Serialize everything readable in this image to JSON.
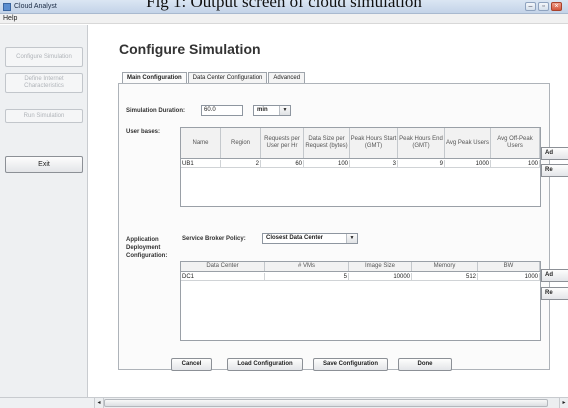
{
  "caption": "Fig 1: Output screen of cloud simulation",
  "window": {
    "title": "Cloud Analyst"
  },
  "menu": {
    "help": "Help"
  },
  "sidebar": {
    "configure": "Configure Simulation",
    "internet": "Define Internet Characteristics",
    "run": "Run Simulation",
    "exit": "Exit"
  },
  "page": {
    "title": "Configure Simulation"
  },
  "tabs": [
    "Main Configuration",
    "Data Center Configuration",
    "Advanced"
  ],
  "simulation": {
    "duration_label": "Simulation Duration:",
    "duration_value": "60.0",
    "unit": "min"
  },
  "user_bases": {
    "label": "User bases:",
    "columns": [
      "Name",
      "Region",
      "Requests per User per Hr",
      "Data Size per Request (bytes)",
      "Peak Hours Start (GMT)",
      "Peak Hours End (GMT)",
      "Avg Peak Users",
      "Avg Off-Peak Users"
    ],
    "rows": [
      [
        "UB1",
        "2",
        "60",
        "100",
        "3",
        "9",
        "1000",
        "100"
      ]
    ],
    "add_label": "Ad",
    "remove_label": "Re"
  },
  "deployment": {
    "label": "Application Deployment Configuration:",
    "policy_label": "Service Broker Policy:",
    "policy_value": "Closest Data Center",
    "columns": [
      "Data Center",
      "# VMs",
      "Image Size",
      "Memory",
      "BW"
    ],
    "rows": [
      [
        "DC1",
        "5",
        "10000",
        "512",
        "1000"
      ]
    ],
    "add_label": "Ad",
    "remove_label": "Re"
  },
  "buttons": {
    "cancel": "Cancel",
    "load": "Load Configuration",
    "save": "Save Configuration",
    "done": "Done"
  }
}
